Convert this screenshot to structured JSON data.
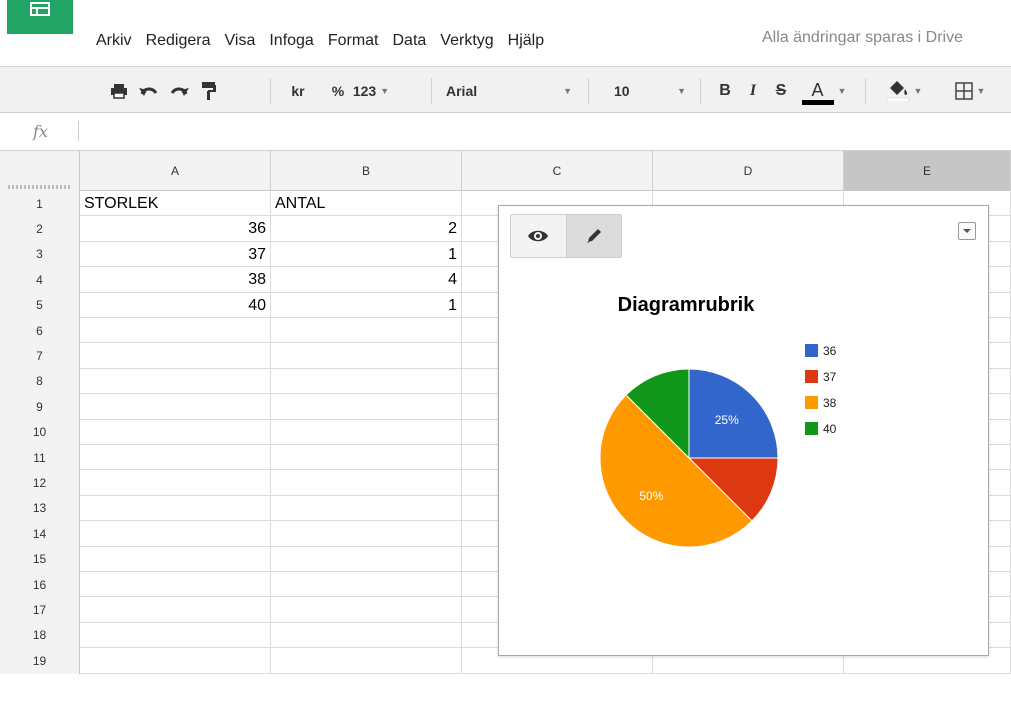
{
  "menu": {
    "items": [
      "Arkiv",
      "Redigera",
      "Visa",
      "Infoga",
      "Format",
      "Data",
      "Verktyg",
      "Hjälp"
    ],
    "save_status": "Alla ändringar sparas i Drive"
  },
  "toolbar": {
    "currency_label": "kr",
    "percent_label": "%",
    "more_formats_label": "123",
    "font_family_value": "Arial",
    "font_size_value": "10",
    "bold_label": "B",
    "italic_label": "I",
    "strike_label": "S",
    "text_color_label": "A"
  },
  "formula_bar": {
    "fx_label": "fx",
    "value": ""
  },
  "columns": [
    "A",
    "B",
    "C",
    "D",
    "E"
  ],
  "rows": [
    "1",
    "2",
    "3",
    "4",
    "5",
    "6",
    "7",
    "8",
    "9",
    "10",
    "11",
    "12",
    "13",
    "14",
    "15",
    "16",
    "17",
    "18",
    "19"
  ],
  "cells": [
    {
      "row": 0,
      "col": 0,
      "value": "STORLEK",
      "align": "left"
    },
    {
      "row": 0,
      "col": 1,
      "value": "ANTAL",
      "align": "left"
    },
    {
      "row": 1,
      "col": 0,
      "value": "36",
      "align": "right"
    },
    {
      "row": 1,
      "col": 1,
      "value": "2",
      "align": "right"
    },
    {
      "row": 2,
      "col": 0,
      "value": "37",
      "align": "right"
    },
    {
      "row": 2,
      "col": 1,
      "value": "1",
      "align": "right"
    },
    {
      "row": 3,
      "col": 0,
      "value": "38",
      "align": "right"
    },
    {
      "row": 3,
      "col": 1,
      "value": "4",
      "align": "right"
    },
    {
      "row": 4,
      "col": 0,
      "value": "40",
      "align": "right"
    },
    {
      "row": 4,
      "col": 1,
      "value": "1",
      "align": "right"
    }
  ],
  "colors": {
    "brand_green": "#21a464",
    "selected_column_header": "#c6c6c6"
  },
  "icons": [
    "print-icon",
    "undo-icon",
    "redo-icon",
    "paint-format-icon",
    "fill-color-icon",
    "borders-icon",
    "eye-icon",
    "pencil-icon",
    "dropdown-icon"
  ],
  "chart_data": {
    "type": "pie",
    "title": "Diagramrubrik",
    "categories": [
      "36",
      "37",
      "38",
      "40"
    ],
    "values": [
      2,
      1,
      4,
      1
    ],
    "colors": [
      "#3366cc",
      "#dc3912",
      "#ff9900",
      "#109618"
    ],
    "slice_labels": [
      "25%",
      "",
      "50%",
      ""
    ],
    "legend_position": "right"
  }
}
